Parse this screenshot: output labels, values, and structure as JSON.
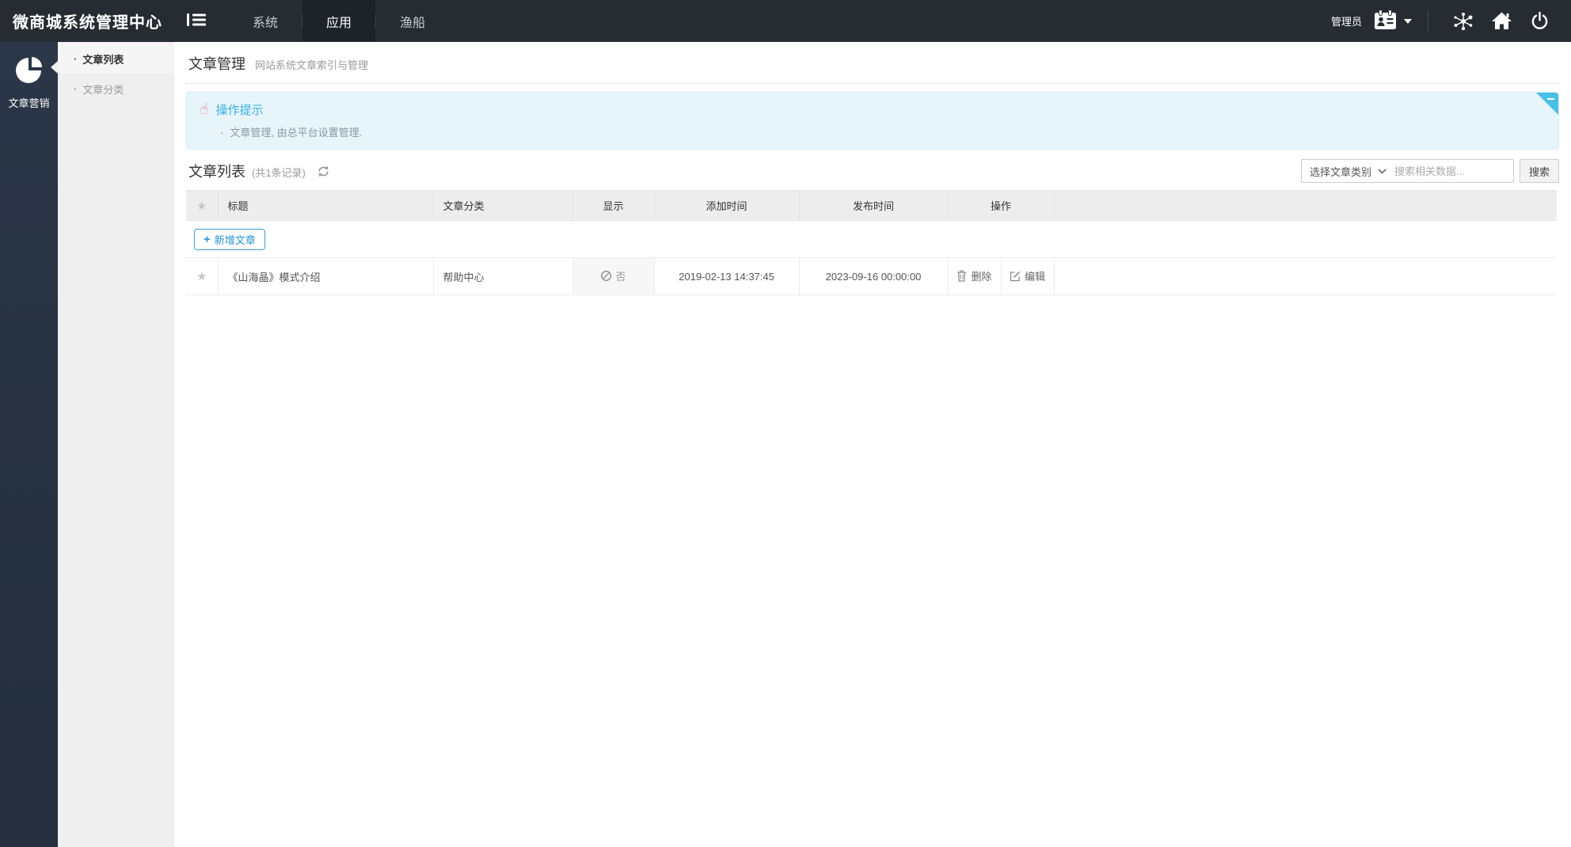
{
  "topbar": {
    "title": "微商城系统管理中心",
    "nav": [
      {
        "label": "系统",
        "active": false
      },
      {
        "label": "应用",
        "active": true
      },
      {
        "label": "渔船",
        "active": false
      }
    ],
    "user_label": "管理员"
  },
  "sidebar": {
    "module_label": "文章营销",
    "items": [
      {
        "label": "文章列表",
        "active": true,
        "bullet": "·"
      },
      {
        "label": "文章分类",
        "active": false,
        "bullet": "·"
      }
    ]
  },
  "page": {
    "title": "文章管理",
    "subtitle": "网站系统文章索引与管理"
  },
  "notice": {
    "title": "操作提示",
    "bullet": "·",
    "line": "文章管理, 由总平台设置管理."
  },
  "section": {
    "title": "文章列表",
    "count": "(共1条记录)"
  },
  "filters": {
    "category_select_value": "选择文章类别",
    "search_placeholder": "搜索相关数据...",
    "search_button": "搜索"
  },
  "table": {
    "add_button": "新增文章",
    "add_plus": "+",
    "headers": [
      "标题",
      "文章分类",
      "显示",
      "添加时间",
      "发布时间",
      "操作"
    ],
    "rows": [
      {
        "title": "《山海晶》模式介绍",
        "category": "帮助中心",
        "visible": "否",
        "added_time": "2019-02-13 14:37:45",
        "publish_time": "2023-09-16 00:00:00",
        "delete_label": "删除",
        "edit_label": "编辑"
      }
    ]
  },
  "icons": {
    "star": "★",
    "hand_pointer": "☝"
  },
  "colors": {
    "topbar_bg": "#272c33",
    "rail_bg": "#273343",
    "submenu_bg": "#efefef",
    "notice_bg": "#e7f5fb",
    "notice_title_blue": "#3aafe0",
    "fold_cyan": "#49c0e8",
    "accent_blue": "#2a95cf"
  }
}
